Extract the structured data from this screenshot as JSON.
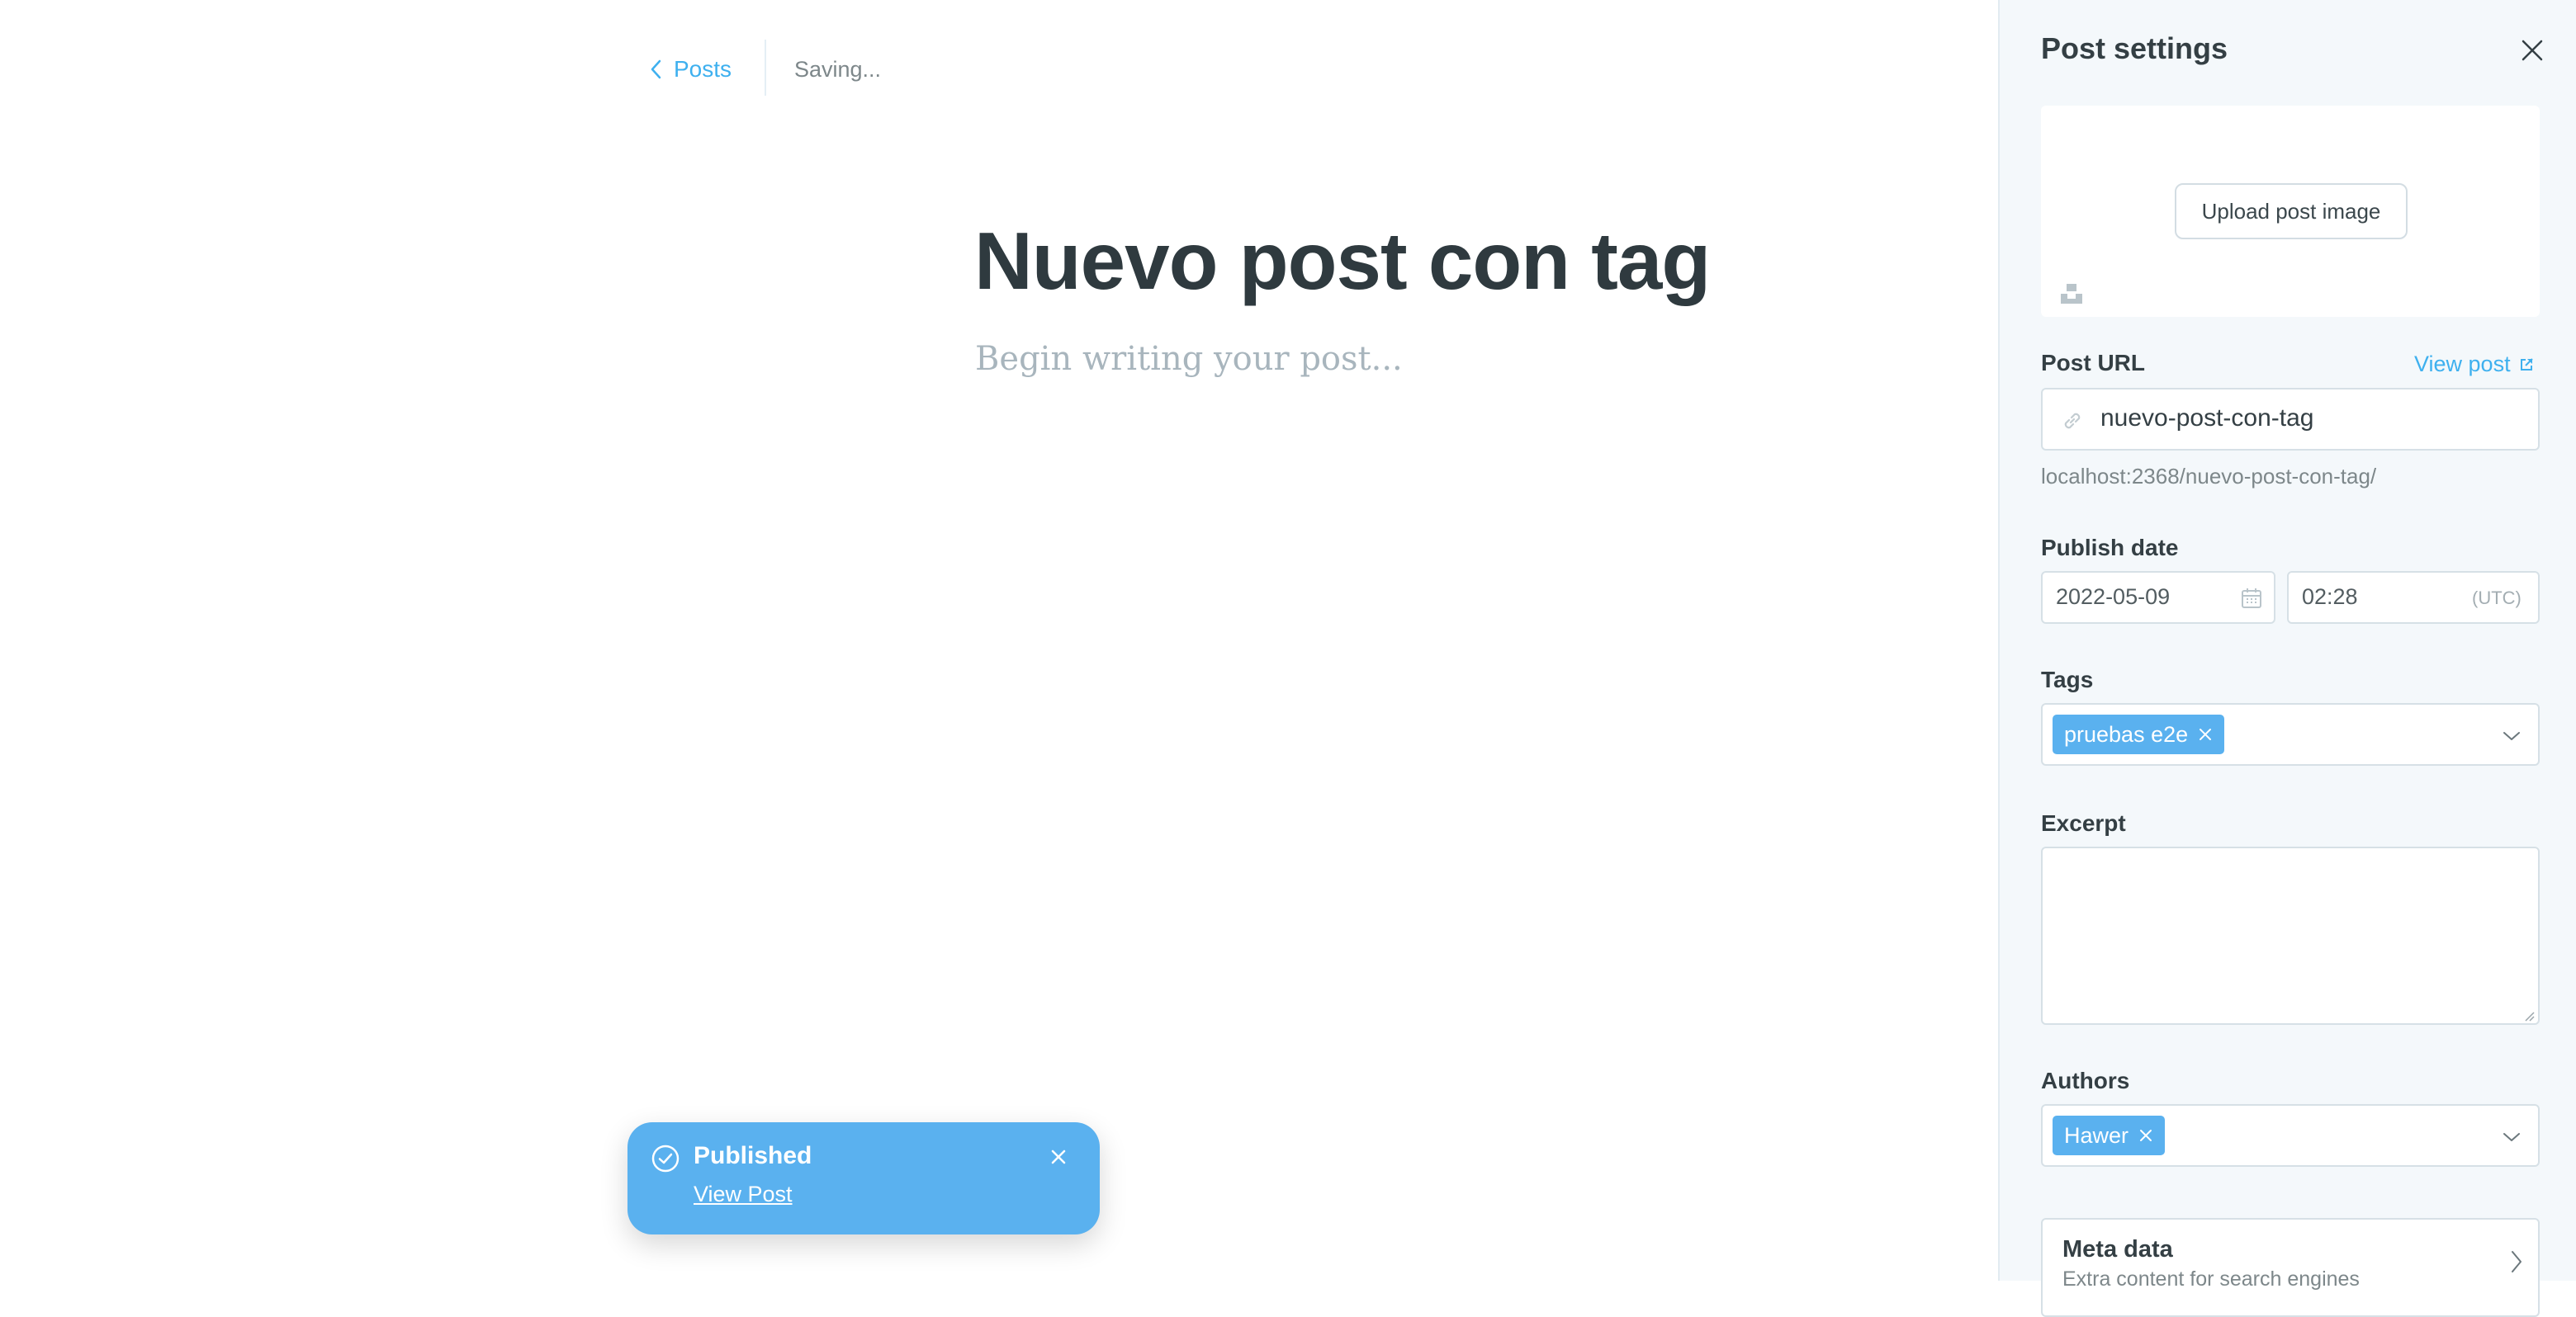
{
  "editor": {
    "back_label": "Posts",
    "save_status": "Saving...",
    "title": "Nuevo post con tag",
    "body_placeholder": "Begin writing your post..."
  },
  "toast": {
    "title": "Published",
    "link": "View Post"
  },
  "settings": {
    "title": "Post settings",
    "upload_label": "Upload post image",
    "url_label": "Post URL",
    "view_post": "View post",
    "url_value": "nuevo-post-con-tag",
    "url_hint": "localhost:2368/nuevo-post-con-tag/",
    "publish_label": "Publish date",
    "date": "2022-05-09",
    "time": "02:28",
    "timezone": "(UTC)",
    "tags_label": "Tags",
    "tags": [
      "pruebas e2e"
    ],
    "excerpt_label": "Excerpt",
    "excerpt_value": "",
    "authors_label": "Authors",
    "authors": [
      "Hawer"
    ],
    "meta_title": "Meta data",
    "meta_subtitle": "Extra content for search engines"
  },
  "colors": {
    "accent": "#3eb0ef",
    "toast_bg": "#5ab1ef",
    "sidebar_bg": "#f4f8fb"
  },
  "icons": [
    "chevron-left-icon",
    "check-circle-icon",
    "close-icon",
    "unsplash-icon",
    "link-icon",
    "external-link-icon",
    "calendar-icon",
    "chevron-down-icon",
    "chevron-right-icon"
  ]
}
